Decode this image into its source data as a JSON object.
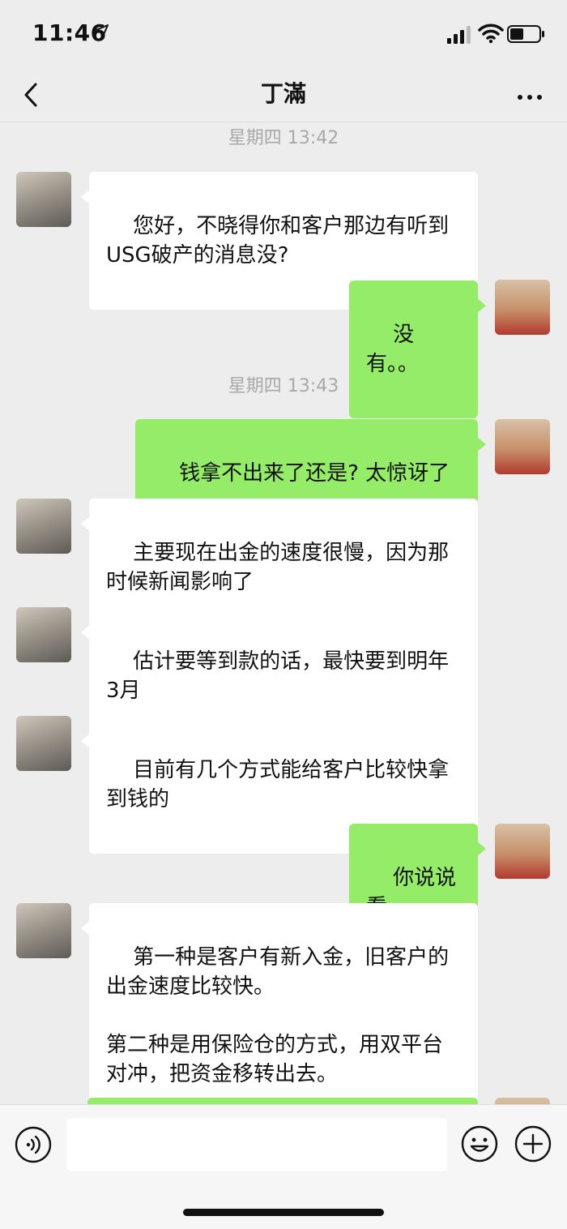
{
  "status_bar": {
    "time": "11:46"
  },
  "nav": {
    "title": "丁滿"
  },
  "messages": {
    "ts1": "星期四 13:42",
    "ts2": "星期四 13:43",
    "m1": "您好，不晓得你和客户那边有听到USG破产的消息没?",
    "m2": "没有。。",
    "m3": "钱拿不出来了还是? 太惊讶了",
    "m4": "主要现在出金的速度很慢，因为那时候新闻影响了",
    "m5": "估计要等到款的话，最快要到明年3月",
    "m6": "目前有几个方式能给客户比较快拿到钱的",
    "m7": "你说说看",
    "m8": "第一种是客户有新入金，旧客户的出金速度比较快。\n\n第二种是用保险仓的方式，用双平台对冲，把资金移转出去。"
  },
  "input": {
    "value": "",
    "placeholder": ""
  },
  "colors": {
    "background": "#ededed",
    "outgoing_bubble": "#95ec69",
    "incoming_bubble": "#ffffff"
  },
  "icons": [
    "back-icon",
    "more-icon",
    "location-arrow-icon",
    "signal-icon",
    "wifi-icon",
    "battery-icon",
    "voice-icon",
    "emoji-icon",
    "plus-icon"
  ]
}
